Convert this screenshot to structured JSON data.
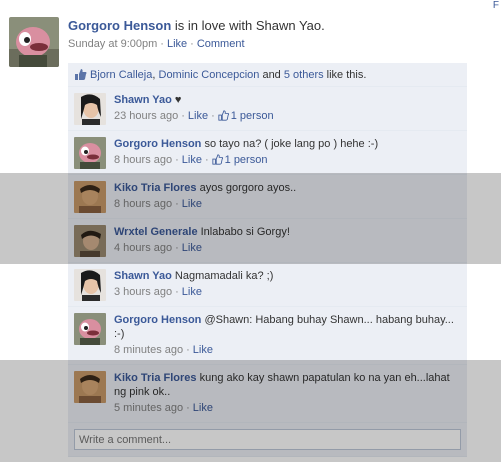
{
  "corner_link": "F",
  "story": {
    "actor": "Gorgoro Henson",
    "headline_rest": " is in love with Shawn Yao.",
    "timestamp": "Sunday at 9:00pm",
    "like_label": "Like",
    "comment_label": "Comment",
    "separator": "·"
  },
  "likes": {
    "name1": "Bjorn Calleja",
    "comma": ", ",
    "name2": "Dominic Concepcion",
    "and": " and ",
    "others": "5 others",
    "tail": " like this."
  },
  "comments": [
    {
      "author": "Shawn Yao",
      "text": " ♥",
      "time": "23 hours ago",
      "like_label": "Like",
      "likes_count": "1 person",
      "avatar": "woman-photo"
    },
    {
      "author": "Gorgoro Henson",
      "text": " so tayo na? ( joke lang po ) hehe :-)",
      "time": "8 hours ago",
      "like_label": "Like",
      "likes_count": "1 person",
      "avatar": "puppet-photo"
    },
    {
      "author": "Kiko Tria Flores",
      "text": " ayos gorgoro ayos..",
      "time": "8 hours ago",
      "like_label": "Like",
      "avatar": "man-photo"
    },
    {
      "author": "Wrxtel Generale",
      "text": " Inlababo si Gorgy!",
      "time": "4 hours ago",
      "like_label": "Like",
      "avatar": "person-photo"
    },
    {
      "author": "Shawn Yao",
      "text": " Nagmamadali ka? ;)",
      "time": "3 hours ago",
      "like_label": "Like",
      "avatar": "woman-photo"
    },
    {
      "author": "Gorgoro Henson",
      "text": " @Shawn: Habang buhay Shawn... habang buhay... :-)",
      "time": "8 minutes ago",
      "like_label": "Like",
      "avatar": "puppet-photo"
    },
    {
      "author": "Kiko Tria Flores",
      "text": " kung ako kay shawn papatulan ko na yan eh...lahat ng pink ok..",
      "time": "5 minutes ago",
      "like_label": "Like",
      "avatar": "man-photo"
    }
  ],
  "write_comment": {
    "placeholder": "Write a comment..."
  },
  "colors": {
    "link": "#3b5998",
    "ufi_bg": "#eceff5",
    "meta": "#808080"
  }
}
